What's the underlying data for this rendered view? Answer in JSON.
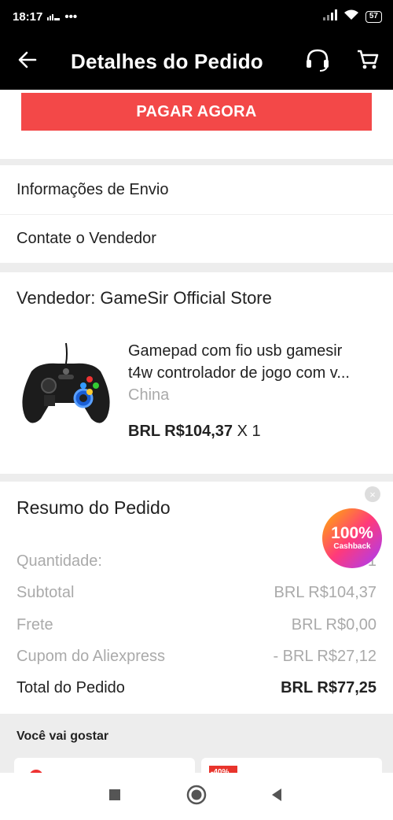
{
  "status_bar": {
    "time": "18:17",
    "extra": "•••",
    "battery": "57"
  },
  "header": {
    "title": "Detalhes do Pedido",
    "back_icon": "arrow-left-icon",
    "support_icon": "headset-icon",
    "cart_icon": "cart-icon"
  },
  "pay": {
    "label": "PAGAR AGORA",
    "color": "#f34848"
  },
  "links": [
    {
      "label": "Informações de Envio"
    },
    {
      "label": "Contate o Vendedor"
    }
  ],
  "seller": {
    "name": "Vendedor: GameSir Official Store"
  },
  "product": {
    "title_line1": "Gamepad com fio usb gamesir",
    "title_line2": "t4w controlador de jogo com v...",
    "origin": "China",
    "price": "BRL R$104,37",
    "quantity": "X 1"
  },
  "summary": {
    "title": "Resumo do Pedido",
    "rows": [
      {
        "label": "Quantidade:",
        "value": "1"
      },
      {
        "label": "Subtotal",
        "value": "BRL R$104,37"
      },
      {
        "label": "Frete",
        "value": "BRL R$0,00"
      },
      {
        "label": "Cupom do Aliexpress",
        "value": "- BRL R$27,12"
      }
    ],
    "total": {
      "label": "Total do Pedido",
      "value": "BRL R$77,25"
    }
  },
  "cashback": {
    "percent": "100%",
    "label": "Cashback",
    "close": "×"
  },
  "recommend": {
    "title": "Você vai gostar",
    "badge": "-40%"
  },
  "nav": {
    "recents_icon": "square-icon",
    "home_icon": "circle-icon",
    "back_icon": "triangle-back-icon"
  }
}
